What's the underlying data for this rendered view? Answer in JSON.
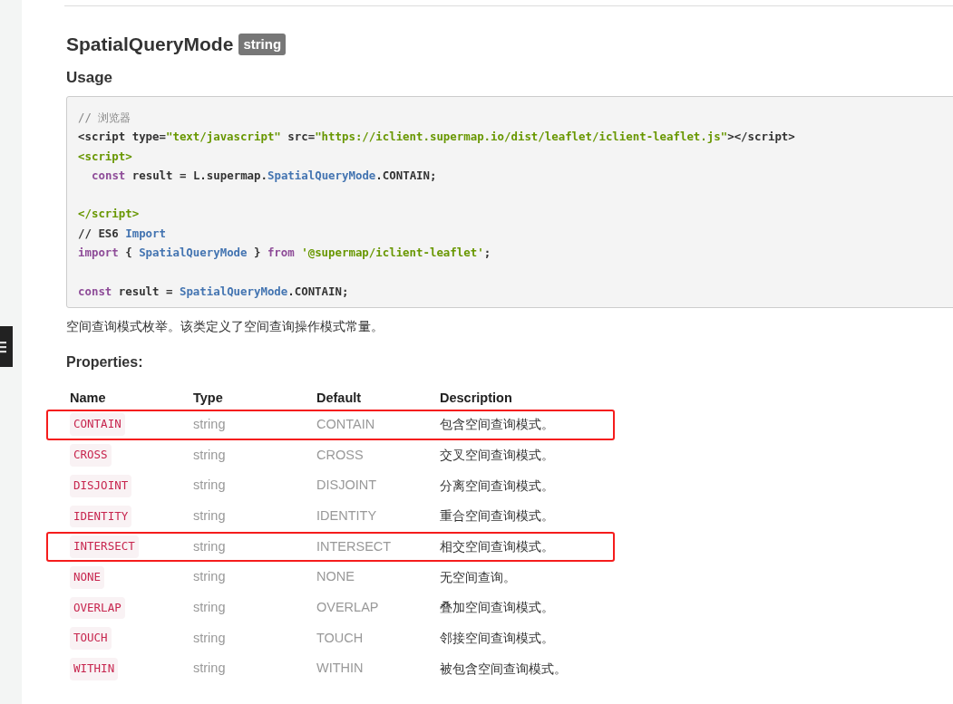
{
  "title": "SpatialQueryMode",
  "title_badge": "string",
  "usage_heading": "Usage",
  "code_lines": [
    {
      "kind": "code",
      "segments": [
        {
          "kind": "comment",
          "t": "// 浏览器"
        }
      ]
    },
    {
      "kind": "code",
      "segments": [
        {
          "kind": "plain",
          "t": "<script type="
        },
        {
          "kind": "string",
          "t": "\"text/javascript\""
        },
        {
          "kind": "plain",
          "t": " src="
        },
        {
          "kind": "string",
          "t": "\"https://iclient.supermap.io/dist/leaflet/iclient-leaflet.js\""
        },
        {
          "kind": "plain",
          "t": "></script>"
        }
      ]
    },
    {
      "kind": "code",
      "segments": [
        {
          "kind": "tag",
          "t": "<script>"
        }
      ]
    },
    {
      "kind": "indented_code",
      "segments": [
        {
          "kind": "keyword",
          "t": "const"
        },
        {
          "kind": "plain",
          "t": " result = L.supermap."
        },
        {
          "kind": "class",
          "t": "SpatialQueryMode"
        },
        {
          "kind": "plain",
          "t": ".CONTAIN;"
        }
      ]
    },
    {
      "kind": "blank"
    },
    {
      "kind": "code",
      "segments": [
        {
          "kind": "tag",
          "t": "</script>"
        }
      ]
    },
    {
      "kind": "code",
      "segments": [
        {
          "kind": "plain",
          "t": "// ES6 "
        },
        {
          "kind": "class",
          "t": "Import"
        }
      ]
    },
    {
      "kind": "code",
      "segments": [
        {
          "kind": "keyword",
          "t": "import"
        },
        {
          "kind": "plain",
          "t": " { "
        },
        {
          "kind": "class",
          "t": "SpatialQueryMode"
        },
        {
          "kind": "plain",
          "t": " } "
        },
        {
          "kind": "keyword",
          "t": "from "
        },
        {
          "kind": "string",
          "t": "'@supermap/iclient-leaflet'"
        },
        {
          "kind": "plain",
          "t": ";"
        }
      ]
    },
    {
      "kind": "blank"
    },
    {
      "kind": "code",
      "segments": [
        {
          "kind": "keyword",
          "t": "const"
        },
        {
          "kind": "plain",
          "t": " result = "
        },
        {
          "kind": "class",
          "t": "SpatialQueryMode"
        },
        {
          "kind": "plain",
          "t": ".CONTAIN;"
        }
      ]
    }
  ],
  "description": "空间查询模式枚举。该类定义了空间查询操作模式常量。",
  "properties_heading": "Properties:",
  "table": {
    "columns": [
      "Name",
      "Type",
      "Default",
      "Description"
    ],
    "rows": [
      {
        "name": "CONTAIN",
        "type": "string",
        "default": "CONTAIN",
        "description": "包含空间查询模式。",
        "highlighted": true
      },
      {
        "name": "CROSS",
        "type": "string",
        "default": "CROSS",
        "description": "交叉空间查询模式。",
        "highlighted": false
      },
      {
        "name": "DISJOINT",
        "type": "string",
        "default": "DISJOINT",
        "description": "分离空间查询模式。",
        "highlighted": false
      },
      {
        "name": "IDENTITY",
        "type": "string",
        "default": "IDENTITY",
        "description": "重合空间查询模式。",
        "highlighted": false
      },
      {
        "name": "INTERSECT",
        "type": "string",
        "default": "INTERSECT",
        "description": "相交空间查询模式。",
        "highlighted": true
      },
      {
        "name": "NONE",
        "type": "string",
        "default": "NONE",
        "description": "无空间查询。",
        "highlighted": false
      },
      {
        "name": "OVERLAP",
        "type": "string",
        "default": "OVERLAP",
        "description": "叠加空间查询模式。",
        "highlighted": false
      },
      {
        "name": "TOUCH",
        "type": "string",
        "default": "TOUCH",
        "description": "邻接空间查询模式。",
        "highlighted": false
      },
      {
        "name": "WITHIN",
        "type": "string",
        "default": "WITHIN",
        "description": "被包含空间查询模式。",
        "highlighted": false
      }
    ]
  }
}
